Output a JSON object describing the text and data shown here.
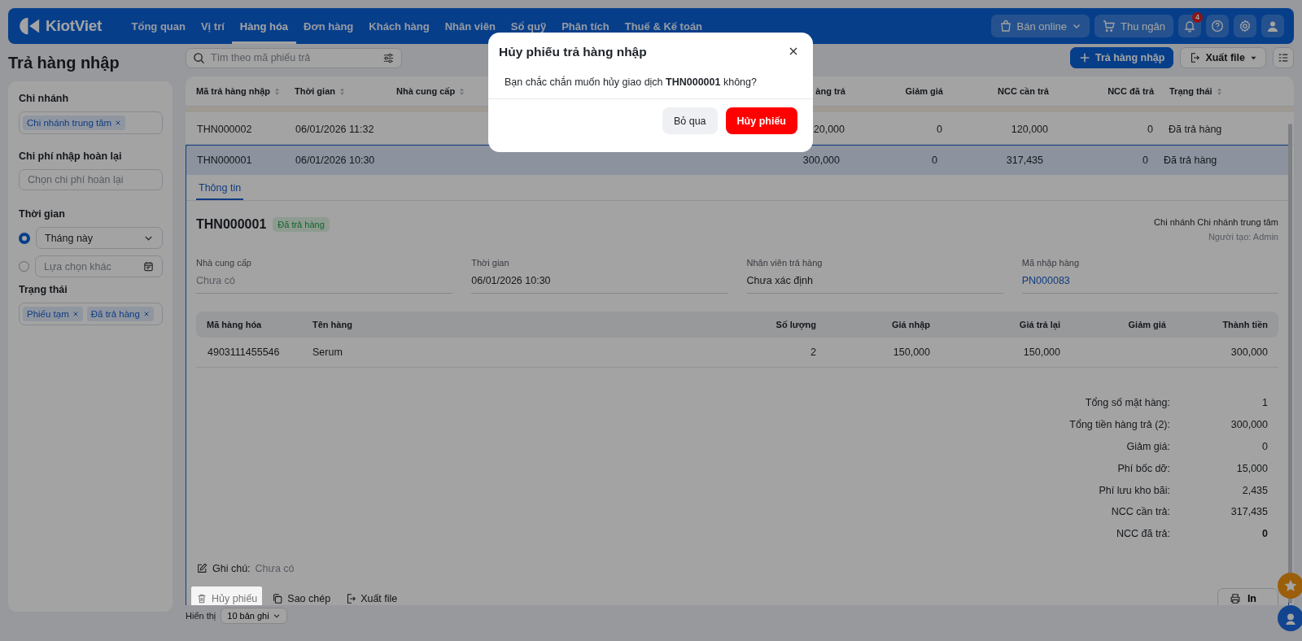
{
  "nav": {
    "logo": "KiotViet",
    "items": [
      {
        "label": "Tổng quan",
        "selected": false
      },
      {
        "label": "Vị trí",
        "selected": false
      },
      {
        "label": "Hàng hóa",
        "selected": true
      },
      {
        "label": "Đơn hàng",
        "selected": false
      },
      {
        "label": "Khách hàng",
        "selected": false
      },
      {
        "label": "Nhân viên",
        "selected": false
      },
      {
        "label": "Sổ quỹ",
        "selected": false
      },
      {
        "label": "Phân tích",
        "selected": false
      },
      {
        "label": "Thuế & Kế toán",
        "selected": false
      }
    ],
    "online_button": "Bán online",
    "cashier_button": "Thu ngân",
    "notification_count": "4"
  },
  "page_title": "Trả hàng nhập",
  "search": {
    "placeholder": "Tìm theo mã phiếu trả"
  },
  "toolbar": [
    {
      "label": "Trả hàng nhập",
      "kind": "primary"
    },
    {
      "label": "Xuất file",
      "kind": "export"
    }
  ],
  "filters": {
    "branch": {
      "label": "Chi nhánh",
      "tags": [
        "Chi nhánh trung tâm"
      ]
    },
    "cost": {
      "label": "Chi phí nhập hoàn lại",
      "placeholder": "Chọn chi phí hoàn lại"
    },
    "time": {
      "label": "Thời gian",
      "options": [
        {
          "kind": "select",
          "text": "Tháng này",
          "selected": true
        },
        {
          "kind": "date",
          "text": "Lựa chọn khác",
          "selected": false
        }
      ]
    },
    "status": {
      "label": "Trạng thái",
      "tags": [
        "Phiếu tạm",
        "Đã trả hàng"
      ]
    }
  },
  "table": {
    "columns": [
      {
        "label": "Mã trả hàng nhập",
        "sortable": true
      },
      {
        "label": "Thời gian",
        "sortable": true
      },
      {
        "label": "Nhà cung cấp",
        "sortable": true
      },
      {
        "label": "àng trả",
        "sortable": false
      },
      {
        "label": "Giảm giá",
        "sortable": false
      },
      {
        "label": "NCC cần trả",
        "sortable": false
      },
      {
        "label": "NCC đã trả",
        "sortable": false
      },
      {
        "label": "Trạng thái",
        "sortable": true
      }
    ],
    "rows": [
      {
        "selected": false,
        "cells": [
          "THN000002",
          "06/01/2026 11:32",
          "",
          "20,000",
          "0",
          "120,000",
          "0",
          "Đã trả hàng"
        ]
      },
      {
        "selected": true,
        "cells": [
          "THN000001",
          "06/01/2026 10:30",
          "",
          "300,000",
          "0",
          "317,435",
          "0",
          "Đã trả hàng"
        ]
      }
    ]
  },
  "detail": {
    "tabs": [
      {
        "label": "Thông tin",
        "selected": true
      }
    ],
    "code": "THN000001",
    "status": "Đã trả hàng",
    "branch_line": "Chi nhánh Chi nhánh trung tâm",
    "creator": "Người tạo: Admin",
    "fields": [
      {
        "label": "Nhà cung cấp",
        "value": "Chưa có",
        "kind": "empty"
      },
      {
        "label": "Thời gian",
        "value": "06/01/2026 10:30",
        "kind": "text"
      },
      {
        "label": "Nhân viên trả hàng",
        "value": "Chưa xác định",
        "kind": "text"
      },
      {
        "label": "Mã nhập hàng",
        "value": "PN000083",
        "kind": "link"
      }
    ],
    "item_columns": [
      "Mã hàng hóa",
      "Tên hàng",
      "Số lượng",
      "Giá nhập",
      "Giá trả lại",
      "Giảm giá",
      "Thành tiền"
    ],
    "item_rows": [
      [
        "4903111455546",
        "Serum",
        "2",
        "150,000",
        "150,000",
        "",
        "300,000"
      ]
    ],
    "summary": [
      {
        "label": "Tổng số mặt hàng:",
        "value": "1",
        "bold": false
      },
      {
        "label": "Tổng tiền hàng trả (2):",
        "value": "300,000",
        "bold": false
      },
      {
        "label": "Giảm giá:",
        "value": "0",
        "bold": false
      },
      {
        "label": "Phí bốc dỡ:",
        "value": "15,000",
        "bold": false
      },
      {
        "label": "Phí lưu kho bãi:",
        "value": "2,435",
        "bold": false
      },
      {
        "label": "NCC cần trả:",
        "value": "317,435",
        "bold": false
      },
      {
        "label": "NCC đã trả:",
        "value": "0",
        "bold": true
      }
    ],
    "note": {
      "label": "Ghi chú:",
      "value": "Chưa có"
    },
    "actions": [
      {
        "label": "Hủy phiếu",
        "kind": "trash",
        "highlighted": true
      },
      {
        "label": "Sao chép",
        "kind": "copy",
        "highlighted": false
      },
      {
        "label": "Xuất file",
        "kind": "export",
        "highlighted": false
      }
    ],
    "print_button": "In"
  },
  "pagination": {
    "label": "Hiển thị",
    "value": "10 bản ghi"
  },
  "dialog": {
    "title": "Hủy phiếu trả hàng nhập",
    "message": "Bạn chắc chắn muốn hủy giao dịch **THN000001** không?",
    "buttons": [
      {
        "label": "Bỏ qua",
        "kind": "secondary"
      },
      {
        "label": "Hủy phiếu",
        "kind": "danger"
      }
    ]
  }
}
